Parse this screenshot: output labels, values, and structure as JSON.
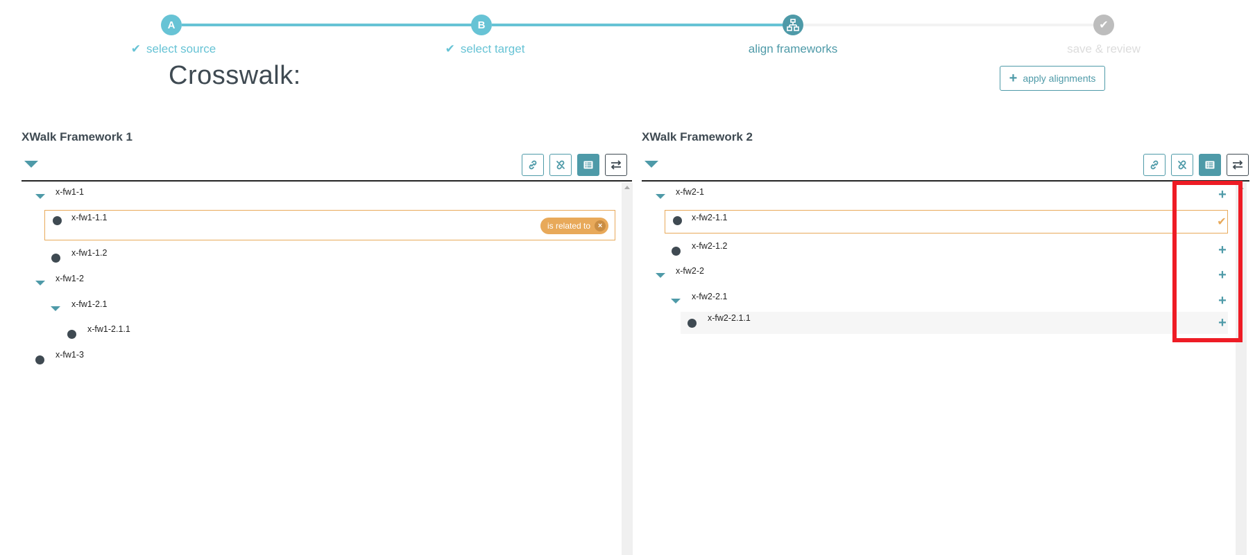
{
  "colors": {
    "accent": "#67c3d5",
    "accent_dark": "#4e9aa8",
    "text_dark": "#3f4a52",
    "inactive": "#bdbdbd",
    "relation": "#e8a95a",
    "highlight": "#ee1c25"
  },
  "stepper": {
    "steps": [
      {
        "badge": "A",
        "label": "select source",
        "state": "complete",
        "icon": "check-icon"
      },
      {
        "badge": "B",
        "label": "select target",
        "state": "complete",
        "icon": "check-icon"
      },
      {
        "badge": "",
        "label": "align frameworks",
        "state": "current",
        "icon": "sitemap-icon"
      },
      {
        "badge": "",
        "label": "save & review",
        "state": "pending",
        "icon": "check-icon"
      }
    ],
    "check_glyph": "✔"
  },
  "page": {
    "title": "Crosswalk:",
    "apply_button": {
      "icon": "plus-icon",
      "label": "apply alignments"
    }
  },
  "framework1": {
    "title": "XWalk Framework 1",
    "toolbar": [
      {
        "name": "link-button",
        "icon": "link-icon",
        "active": false
      },
      {
        "name": "unlink-button",
        "icon": "unlink-icon",
        "active": false
      },
      {
        "name": "list-view-button",
        "icon": "list-icon",
        "active": true
      },
      {
        "name": "swap-button",
        "icon": "swap-icon",
        "active": false
      }
    ],
    "nodes": [
      {
        "label": "x-fw1-1",
        "type": "branch",
        "depth": 0
      },
      {
        "label": "x-fw1-1.1",
        "type": "leaf",
        "depth": 1,
        "selected": true,
        "relation": "is related to"
      },
      {
        "label": "x-fw1-1.2",
        "type": "leaf",
        "depth": 1
      },
      {
        "label": "x-fw1-2",
        "type": "branch",
        "depth": 0
      },
      {
        "label": "x-fw1-2.1",
        "type": "branch",
        "depth": 1
      },
      {
        "label": "x-fw1-2.1.1",
        "type": "leaf",
        "depth": 2
      },
      {
        "label": "x-fw1-3",
        "type": "leaf",
        "depth": 0
      }
    ],
    "relation_remove_glyph": "×"
  },
  "framework2": {
    "title": "XWalk Framework 2",
    "toolbar": [
      {
        "name": "link-button",
        "icon": "link-icon",
        "active": false
      },
      {
        "name": "unlink-button",
        "icon": "unlink-icon",
        "active": false
      },
      {
        "name": "list-view-button",
        "icon": "list-icon",
        "active": true
      },
      {
        "name": "swap-button",
        "icon": "swap-icon",
        "active": false
      }
    ],
    "nodes": [
      {
        "label": "x-fw2-1",
        "type": "branch",
        "depth": 0,
        "action": "add"
      },
      {
        "label": "x-fw2-1.1",
        "type": "leaf",
        "depth": 1,
        "selected": true,
        "action": "aligned"
      },
      {
        "label": "x-fw2-1.2",
        "type": "leaf",
        "depth": 1,
        "action": "add"
      },
      {
        "label": "x-fw2-2",
        "type": "branch",
        "depth": 0,
        "action": "add"
      },
      {
        "label": "x-fw2-2.1",
        "type": "branch",
        "depth": 1,
        "action": "add"
      },
      {
        "label": "x-fw2-2.1.1",
        "type": "leaf",
        "depth": 2,
        "action": "add",
        "hovered": true
      }
    ],
    "action_glyphs": {
      "add": "+",
      "aligned": "✔"
    }
  }
}
